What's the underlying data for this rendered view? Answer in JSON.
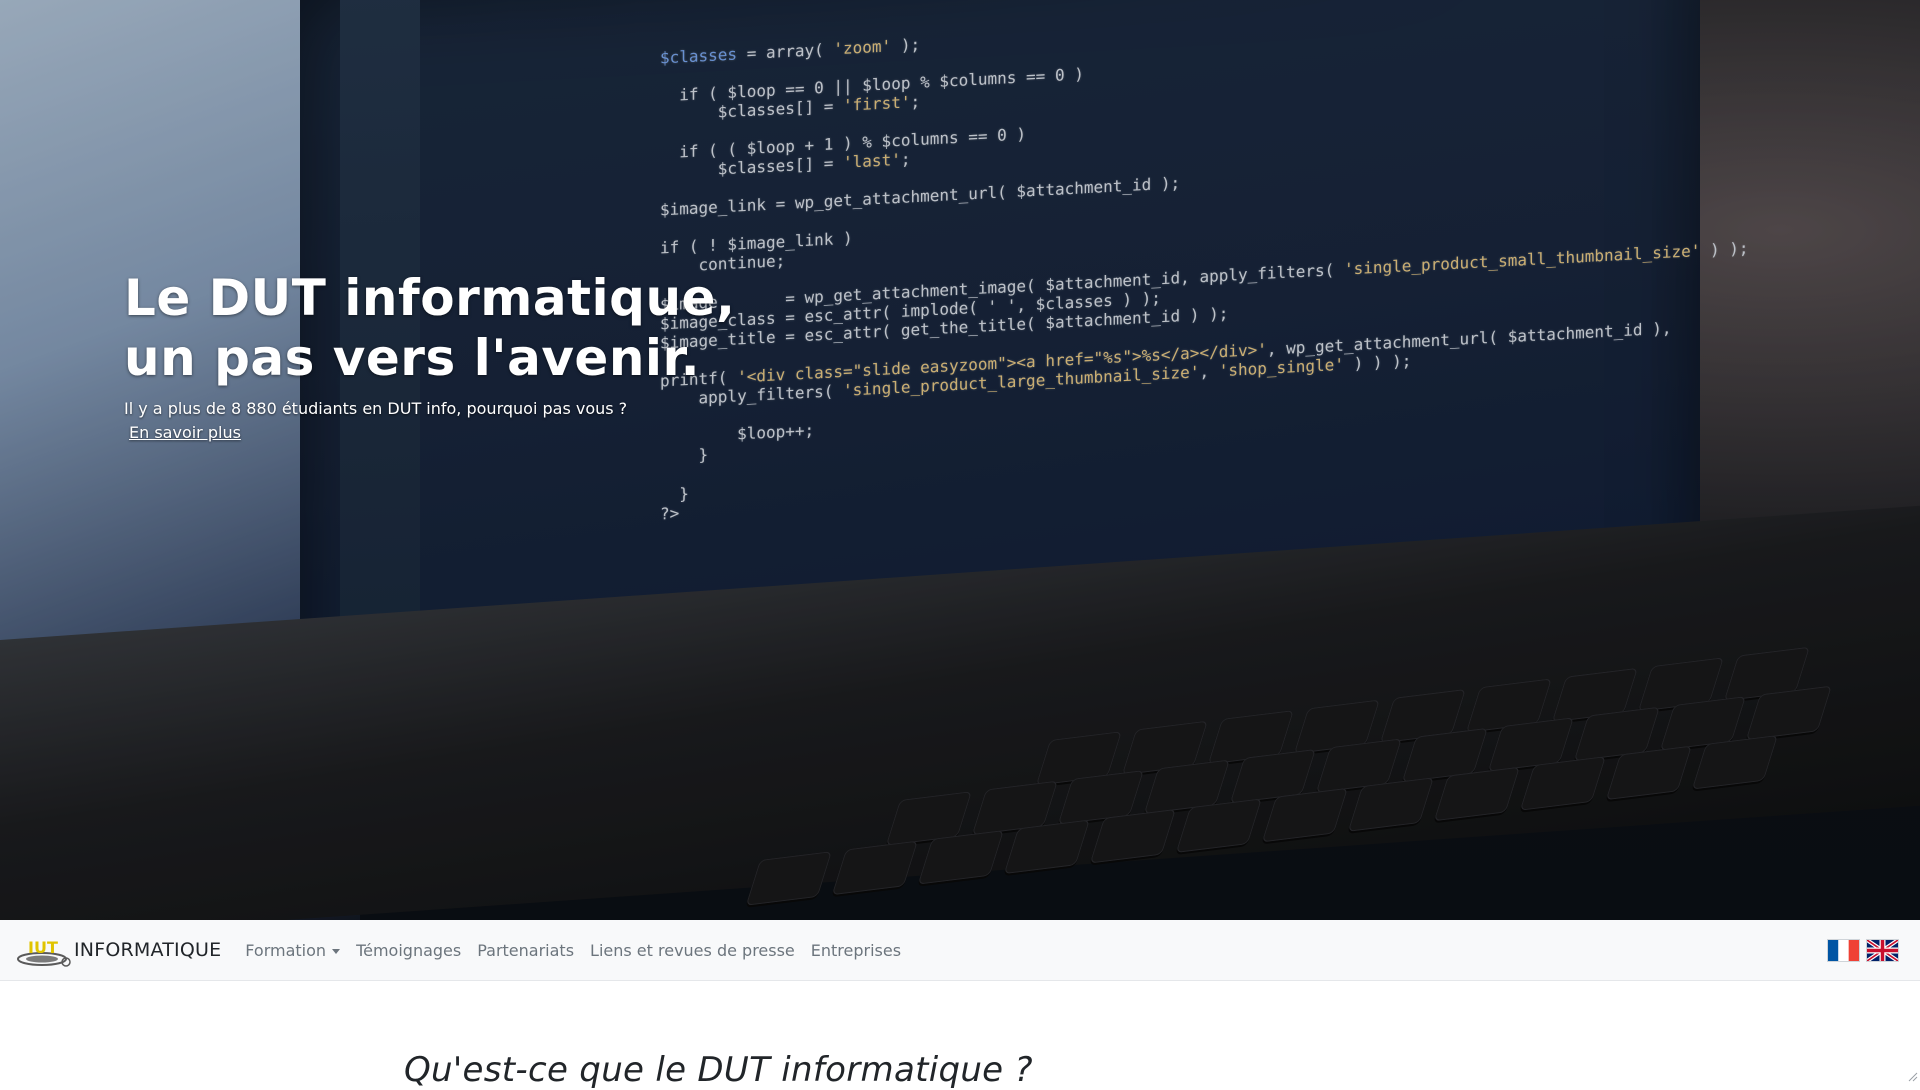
{
  "hero": {
    "title_line1": "Le DUT informatique,",
    "title_line2": "un pas vers l'avenir.",
    "subtitle": "Il y a plus de 8 880 étudiants en DUT info, pourquoi pas vous ?",
    "link_label": "En savoir plus"
  },
  "navbar": {
    "brand_text": "INFORMATIQUE",
    "brand_logo_text": "IUT",
    "items": [
      {
        "label": "Formation",
        "has_dropdown": true
      },
      {
        "label": "Témoignages"
      },
      {
        "label": "Partenariats"
      },
      {
        "label": "Liens et revues de presse"
      },
      {
        "label": "Entreprises"
      }
    ],
    "languages": [
      {
        "icon": "france-flag-icon"
      },
      {
        "icon": "uk-flag-icon"
      }
    ]
  },
  "content": {
    "section_title": "Qu'est-ce que le DUT informatique ?"
  },
  "colors": {
    "navbar_bg": "#f8f9fa",
    "nav_text": "#6c757d",
    "brand_text": "#212529",
    "logo_yellow": "#e0c400"
  }
}
